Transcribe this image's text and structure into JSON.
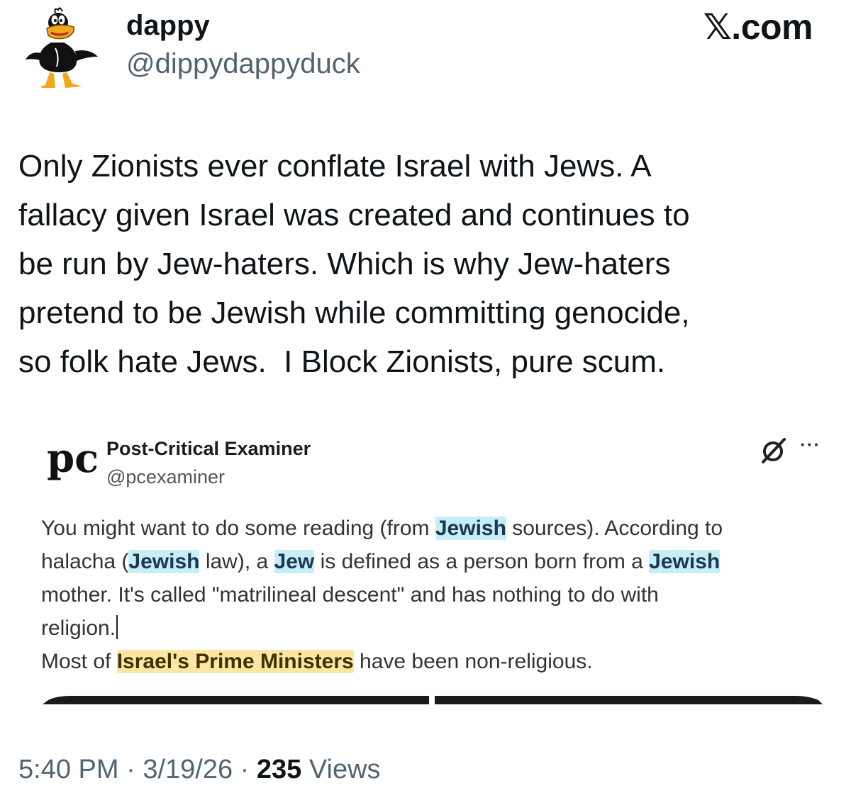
{
  "author": {
    "display_name": "dappy",
    "handle": "@dippydappyduck",
    "avatar_icon": "cartoon-duck-avatar"
  },
  "brand": "𝕏.com",
  "tweet": {
    "line1": "Only Zionists ever conflate Israel with Jews. A",
    "line2": "fallacy given Israel was created and continues to",
    "line3": "be run by Jew-haters. Which is why Jew-haters",
    "line4": "pretend to be Jewish while committing genocide,",
    "line5": "so folk hate Jews.  I Block Zionists, pure scum."
  },
  "embedded": {
    "logo_text": "pc",
    "name": "Post-Critical Examiner",
    "handle": "@pcexaminer",
    "grok_icon": "grok-icon",
    "more_label": "···",
    "body": {
      "s1": "You might want to do some reading (from ",
      "h1": "Jewish",
      "s2": " sources). According to",
      "s3": "halacha (",
      "h2": "Jewish",
      "s4": " law), a ",
      "h3": "Jew",
      "s5": " is defined as a person born from a ",
      "h4": "Jewish",
      "s6": "mother. It's called \"matrilineal descent\" and has nothing to do with",
      "s7": "religion.",
      "s8": "Most of ",
      "h5": "Israel's Prime Ministers",
      "s9": " have been non-religious."
    },
    "highlight_colors": {
      "blue": "#c5eef7",
      "yellow": "#fbe7a2"
    }
  },
  "meta": {
    "time": "5:40 PM",
    "sep": " · ",
    "date": "3/19/26",
    "views_count": "235",
    "views_label": " Views"
  }
}
